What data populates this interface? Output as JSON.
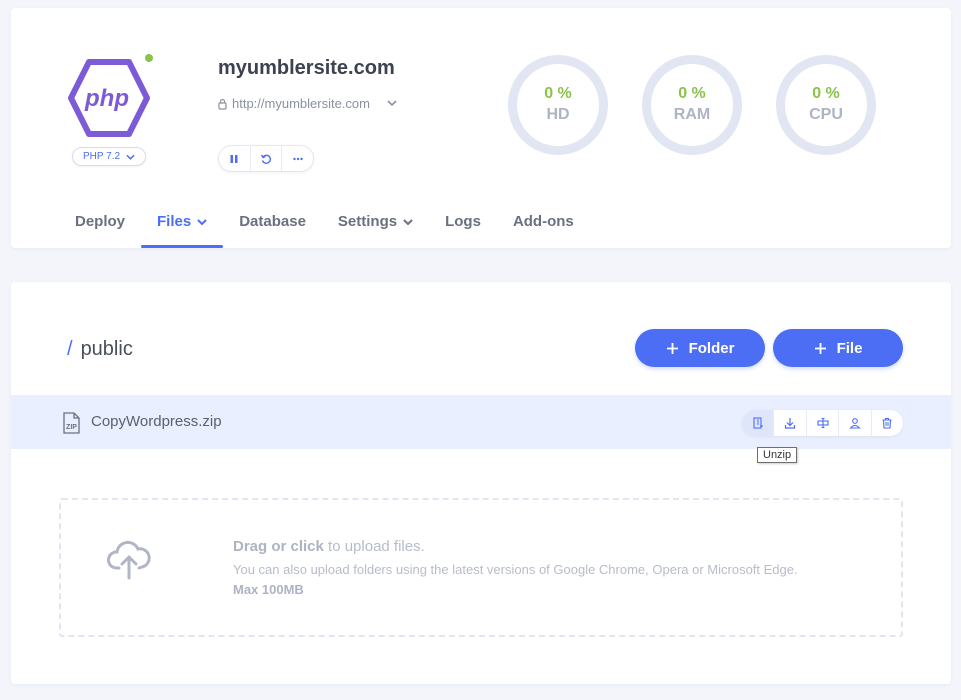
{
  "app": {
    "logo_text": "php",
    "php_version": "PHP 7.2",
    "site_name": "myumblersite.com",
    "site_url": "http://myumblersite.com"
  },
  "stats": [
    {
      "value": "0 %",
      "label": "HD"
    },
    {
      "value": "0 %",
      "label": "RAM"
    },
    {
      "value": "0 %",
      "label": "CPU"
    }
  ],
  "tabs": [
    {
      "label": "Deploy"
    },
    {
      "label": "Files"
    },
    {
      "label": "Database"
    },
    {
      "label": "Settings"
    },
    {
      "label": "Logs"
    },
    {
      "label": "Add-ons"
    }
  ],
  "active_tab": "Files",
  "files": {
    "path_slash": "/",
    "path": "public",
    "folder_button": "Folder",
    "file_button": "File",
    "items": [
      {
        "name": "CopyWordpress.zip",
        "type_badge": "ZIP"
      }
    ],
    "tooltip": "Unzip"
  },
  "upload": {
    "drag_or_click": "Drag or click",
    "to_upload": " to upload files.",
    "hint": "You can also upload folders using the latest versions of Google Chrome, Opera or Microsoft Edge.",
    "max_size": "Max 100MB"
  },
  "icons": {
    "controls": [
      "pause-icon",
      "restart-icon",
      "more-icon"
    ],
    "file_actions": [
      "unzip-icon",
      "download-icon",
      "rename-icon",
      "permissions-icon",
      "delete-icon"
    ]
  },
  "colors": {
    "accent": "#4c6ef5",
    "online": "#8bc34a",
    "logo": "#7c5cd6",
    "row_highlight": "#e9effe"
  }
}
